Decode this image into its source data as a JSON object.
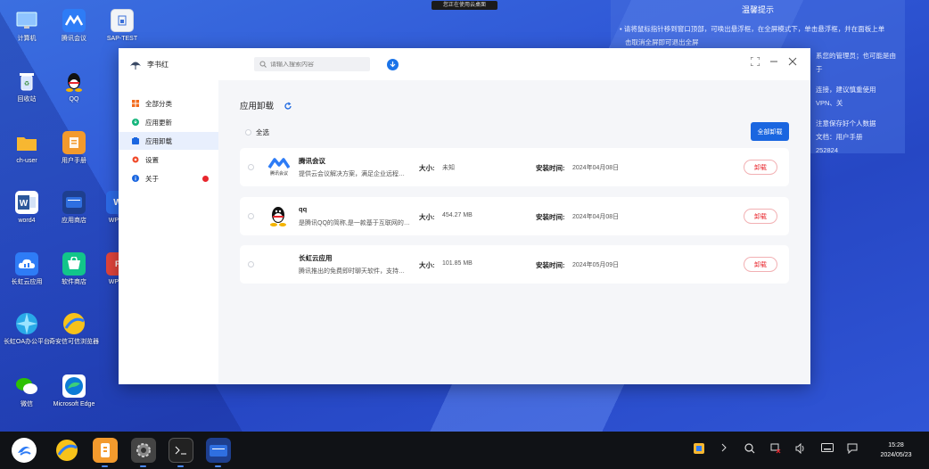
{
  "colors": {
    "accent": "#1a66e0",
    "danger": "#e8262d",
    "sidebar_active": "#e8effd"
  },
  "cloud_banner": "您正在使用云桌面",
  "desktop": [
    {
      "label": "计算机",
      "icon": "monitor-icon"
    },
    {
      "label": "腾讯会议",
      "icon": "tencent-meeting-icon"
    },
    {
      "label": "SAP-TEST",
      "icon": "document-icon"
    },
    {
      "label": "回收站",
      "icon": "recycle-bin-icon"
    },
    {
      "label": "QQ",
      "icon": "qq-icon"
    },
    {
      "label": "ch-user",
      "icon": "folder-icon"
    },
    {
      "label": "用户手册",
      "icon": "manual-icon"
    },
    {
      "label": "word4",
      "icon": "word-icon"
    },
    {
      "label": "应用商店",
      "icon": "app-store-icon"
    },
    {
      "label": "WP",
      "icon": "wps-icon"
    },
    {
      "label": "长虹云应用",
      "icon": "cloud-app-icon"
    },
    {
      "label": "软件商店",
      "icon": "software-store-icon"
    },
    {
      "label": "WP",
      "icon": "wps-pdf-icon"
    },
    {
      "label": "长虹OA办公平台",
      "icon": "oa-icon"
    },
    {
      "label": "奇安信可信浏览器",
      "icon": "browser-icon"
    },
    {
      "label": "微信",
      "icon": "wechat-icon"
    },
    {
      "label": "Microsoft Edge",
      "icon": "edge-icon"
    }
  ],
  "notice": {
    "title": "温馨提示",
    "lines": [
      "• 请将鼠标指针移到窗口顶部，可唤出悬浮框，在全屏模式下，单击悬浮框，并在面板上单",
      "击取消全屏即可退出全屏",
      "系您的管理员；也可能是由于",
      "连接，建议慎重使用VPN、关",
      "注意保存好个人数据",
      "文档：用户手册",
      "252824"
    ]
  },
  "window": {
    "user_name": "李书红",
    "search_placeholder": "请输入搜索内容",
    "sidebar": [
      {
        "label": "全部分类",
        "icon": "grid-icon"
      },
      {
        "label": "应用更新",
        "icon": "update-icon"
      },
      {
        "label": "应用卸载",
        "icon": "uninstall-icon"
      },
      {
        "label": "设置",
        "icon": "settings-icon"
      },
      {
        "label": "关于",
        "icon": "info-icon"
      }
    ],
    "active_index": 2,
    "page_title": "应用卸载",
    "select_all": "全选",
    "uninstall_all": "全部卸载",
    "size_label": "大小:",
    "time_label": "安装时间:",
    "uninstall_label": "卸载",
    "apps": [
      {
        "name": "腾讯会议",
        "desc": "提供云会议解决方案，满足企业远程会议需求",
        "size": "未知",
        "time": "2024年04月08日",
        "icon": "tencent-meeting-icon",
        "icon_text": "腾讯会议"
      },
      {
        "name": "qq",
        "desc": "是腾讯QQ的简称,是一款基于互联网的即时通信软件",
        "size": "454.27 MB",
        "time": "2024年04月08日",
        "icon": "qq-icon"
      },
      {
        "name": "长虹云应用",
        "desc": "腾讯推出的免费即时聊天软件，支持多种功能",
        "size": "101.85 MB",
        "time": "2024年05月09日",
        "icon": "cloud-app-icon"
      }
    ]
  },
  "taskbar": {
    "time": "15:28",
    "date": "2024/05/23"
  }
}
